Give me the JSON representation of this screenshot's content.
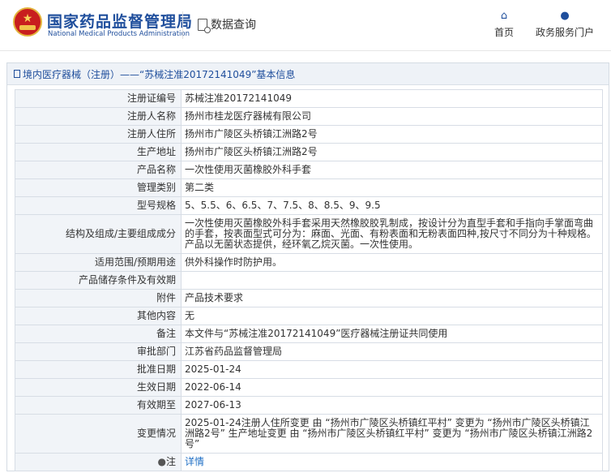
{
  "header": {
    "brand_cn": "国家药品监督管理局",
    "brand_en": "National Medical Products Administration",
    "data_query": "数据查询",
    "nav_home": "首页",
    "nav_portal": "政务服务门户",
    "home_icon": "home-icon",
    "user_icon": "user-icon"
  },
  "panel": {
    "title": "境内医疗器械（注册）——“苏械注准20172141049”基本信息"
  },
  "rows": [
    {
      "key": "注册证编号",
      "value": "苏械注准20172141049"
    },
    {
      "key": "注册人名称",
      "value": "扬州市桂龙医疗器械有限公司"
    },
    {
      "key": "注册人住所",
      "value": "扬州市广陵区头桥镇江洲路2号"
    },
    {
      "key": "生产地址",
      "value": "扬州市广陵区头桥镇江洲路2号"
    },
    {
      "key": "产品名称",
      "value": "一次性使用灭菌橡胶外科手套"
    },
    {
      "key": "管理类别",
      "value": "第二类"
    },
    {
      "key": "型号规格",
      "value": "5、5.5、6、6.5、7、7.5、8、8.5、9、9.5"
    },
    {
      "key": "结构及组成/主要组成成分",
      "value": "一次性使用灭菌橡胶外科手套采用天然橡胶胶乳制成，按设计分为直型手套和手指向手掌面弯曲的手套，按表面型式可分为：麻面、光面、有粉表面和无粉表面四种,按尺寸不同分为十种规格。产品以无菌状态提供，经环氧乙烷灭菌。一次性使用。"
    },
    {
      "key": "适用范围/预期用途",
      "value": "供外科操作时防护用。"
    },
    {
      "key": "产品储存条件及有效期",
      "value": ""
    },
    {
      "key": "附件",
      "value": "产品技术要求"
    },
    {
      "key": "其他内容",
      "value": "无"
    },
    {
      "key": "备注",
      "value": "本文件与“苏械注准20172141049”医疗器械注册证共同使用"
    },
    {
      "key": "审批部门",
      "value": "江苏省药品监督管理局"
    },
    {
      "key": "批准日期",
      "value": "2025-01-24"
    },
    {
      "key": "生效日期",
      "value": "2022-06-14"
    },
    {
      "key": "有效期至",
      "value": "2027-06-13"
    },
    {
      "key": "变更情况",
      "value": "2025-01-24注册人住所变更 由 “扬州市广陵区头桥镇红平村” 变更为 “扬州市广陵区头桥镇江洲路2号” 生产地址变更 由 “扬州市广陵区头桥镇红平村” 变更为 “扬州市广陵区头桥镇江洲路2号”"
    },
    {
      "key": "注",
      "value": "详情"
    }
  ]
}
